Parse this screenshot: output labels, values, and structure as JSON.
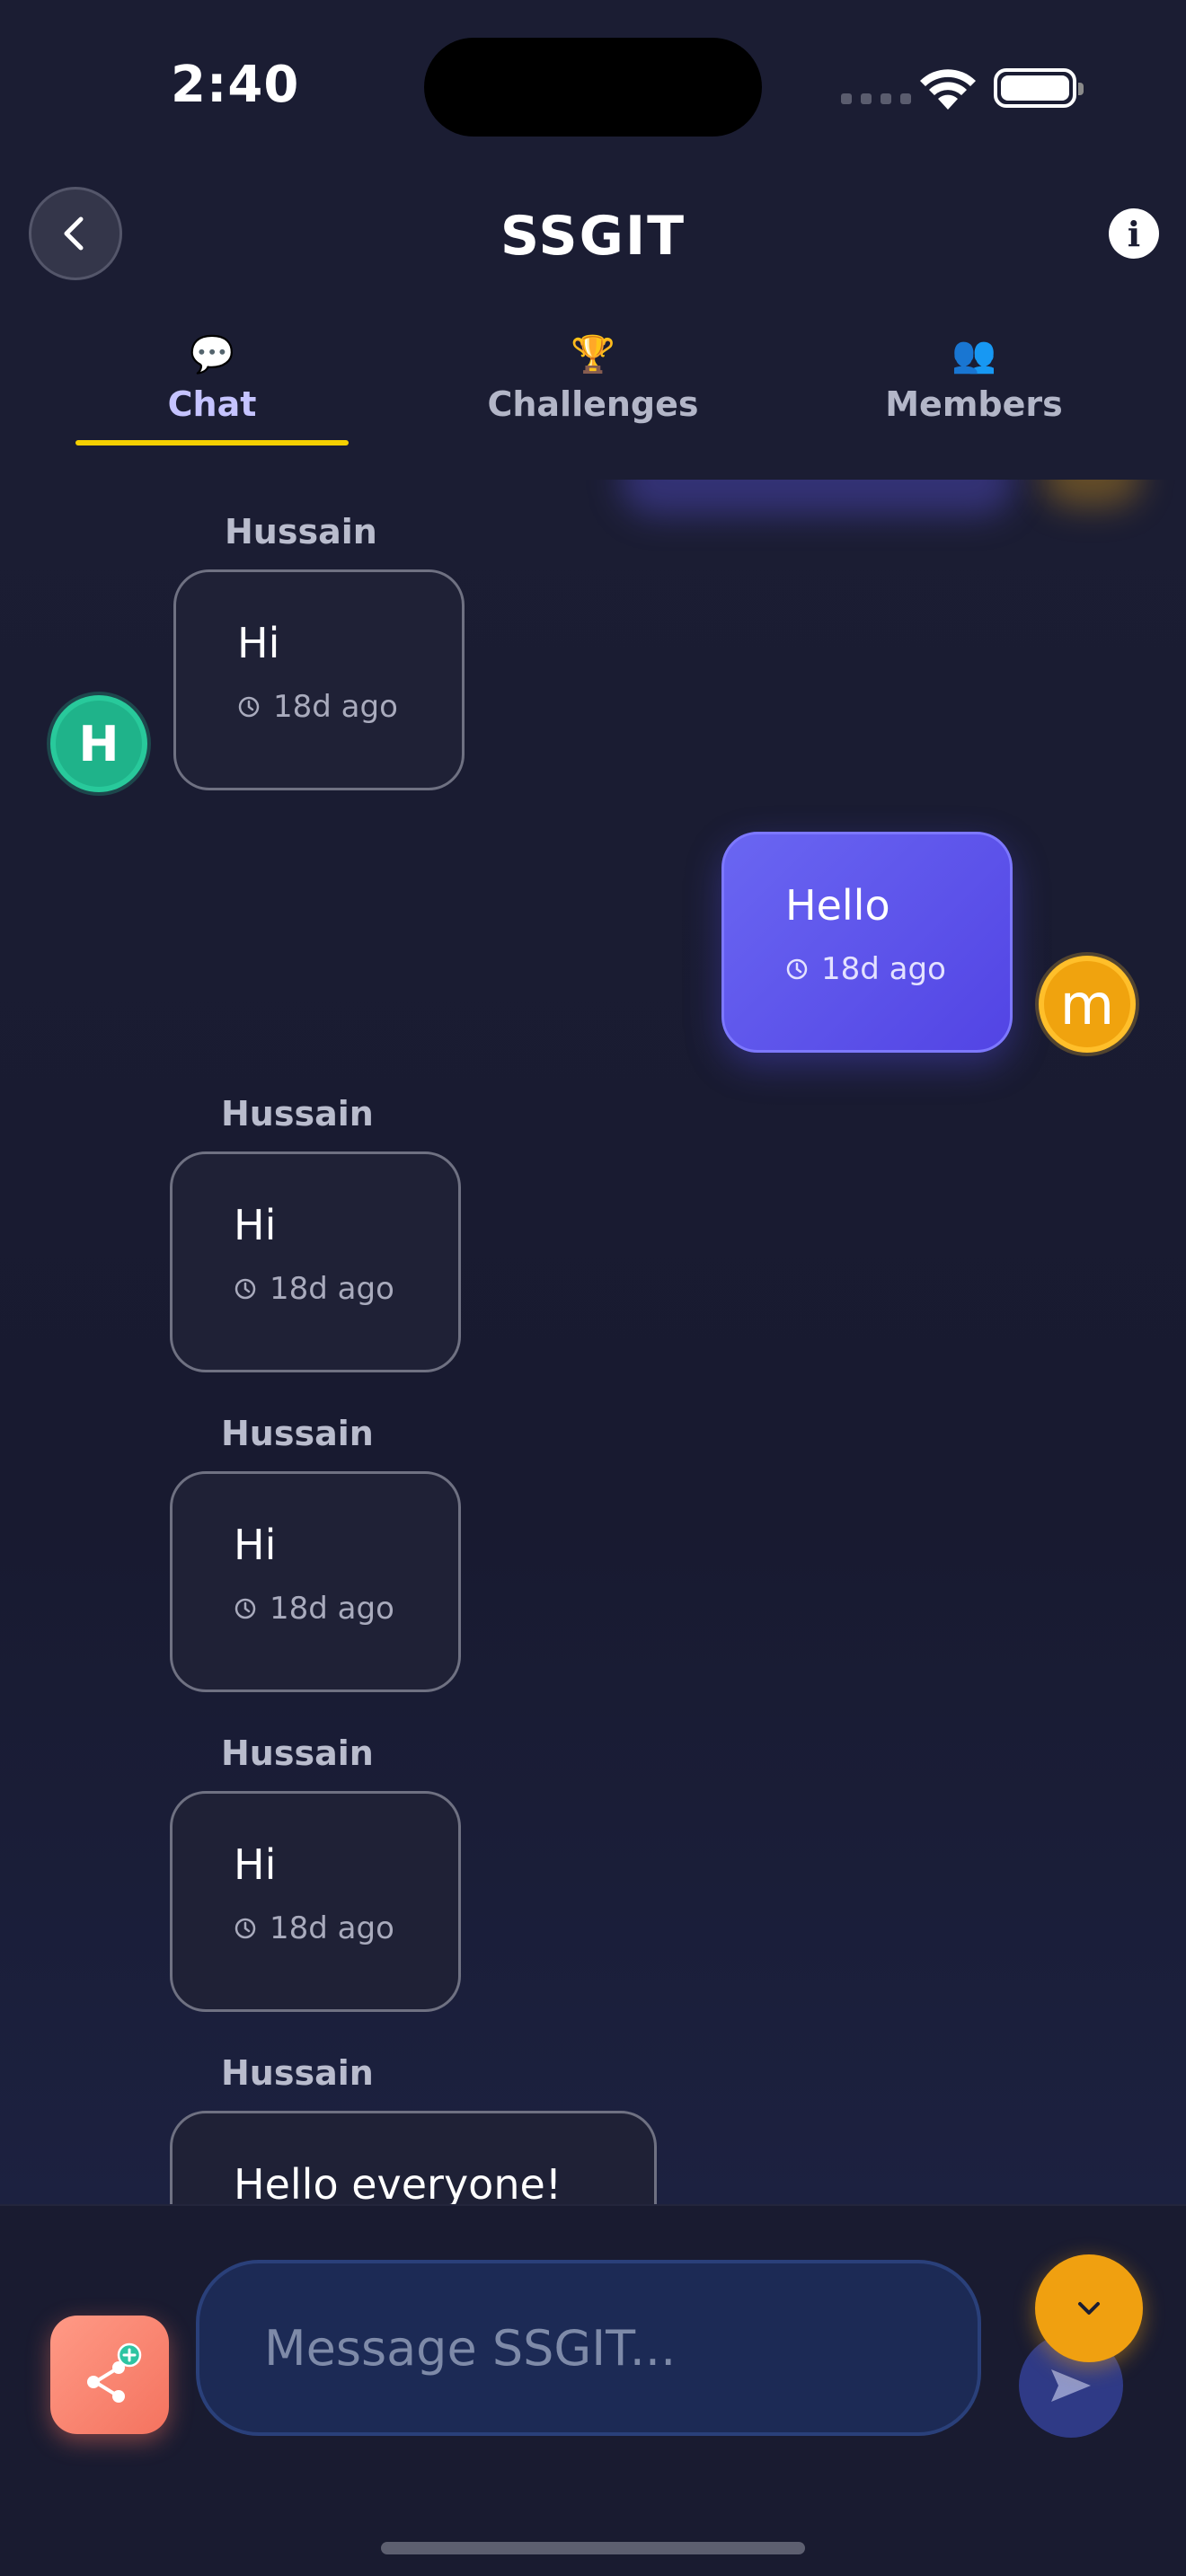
{
  "status_bar": {
    "time": "2:40"
  },
  "header": {
    "title": "SSGIT",
    "tabs": [
      {
        "label": "Chat",
        "icon": "💬",
        "active": true
      },
      {
        "label": "Challenges",
        "icon": "🏆",
        "active": false
      },
      {
        "label": "Members",
        "icon": "👥",
        "active": false
      }
    ]
  },
  "messages": [
    {
      "sender": "Hussain",
      "text": "Hi",
      "time": "18d ago",
      "own": false,
      "avatar_initial": "H"
    },
    {
      "sender": "",
      "text": "Hello",
      "time": "18d ago",
      "own": true,
      "avatar_initial": "m"
    },
    {
      "sender": "Hussain",
      "text": "Hi",
      "time": "18d ago",
      "own": false
    },
    {
      "sender": "Hussain",
      "text": "Hi",
      "time": "18d ago",
      "own": false
    },
    {
      "sender": "Hussain",
      "text": "Hi",
      "time": "18d ago",
      "own": false
    },
    {
      "sender": "Hussain",
      "text": "Hello everyone!",
      "time": "",
      "own": false
    }
  ],
  "composer": {
    "placeholder": "Message SSGIT..."
  },
  "colors": {
    "accent": "#f5d000",
    "own_bubble": "#5b54ec",
    "share_button": "#f4735f",
    "avatar_green": "#1fb38a",
    "avatar_orange": "#f0a30e"
  }
}
